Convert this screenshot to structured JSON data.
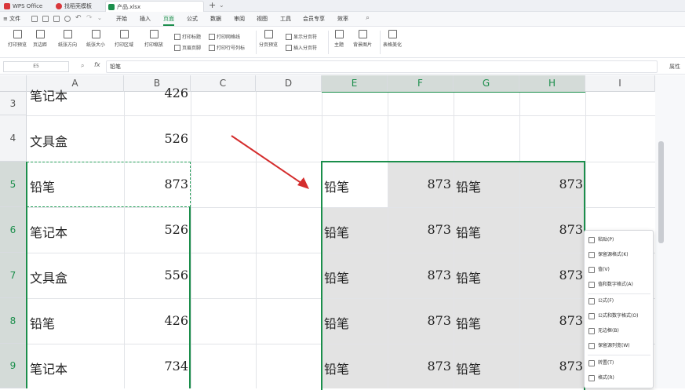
{
  "titlebar": {
    "tabs": [
      {
        "label": "WPS Office",
        "color": "#d9373b"
      },
      {
        "label": "找稻壳模板",
        "color": "#d9373b"
      },
      {
        "label": "产品.xlsx",
        "color": "#1b8e4b"
      }
    ],
    "new_tab": "+",
    "dropdown": "⌄"
  },
  "menubar": {
    "file": "文件",
    "items": [
      "开始",
      "插入",
      "页面",
      "公式",
      "数据",
      "审阅",
      "视图",
      "工具",
      "会员专享",
      "效率"
    ],
    "active_index": 2
  },
  "ribbon": {
    "buttons": [
      "打印预览",
      "页边距",
      "纸张方向",
      "纸张大小",
      "打印区域",
      "打印缩放",
      "分页预览",
      "主题",
      "背景图片",
      "表格美化"
    ],
    "small": [
      "打印标题",
      "页眉页脚",
      "打印网格线",
      "打印行号列标",
      "显示分页符",
      "插入分页符"
    ]
  },
  "formula_bar": {
    "cell_ref": "E5",
    "fx": "fx",
    "content": "铅笔",
    "side_panel": "属性"
  },
  "grid": {
    "columns": [
      "A",
      "B",
      "C",
      "D",
      "E",
      "F",
      "G",
      "H",
      "I"
    ],
    "selected_columns": [
      "E",
      "F",
      "G",
      "H"
    ],
    "rows": [
      {
        "num": "3",
        "a": "笔记本",
        "b": "426",
        "e": "",
        "f": "",
        "g": "",
        "h": ""
      },
      {
        "num": "4",
        "a": "文具盒",
        "b": "526",
        "e": "",
        "f": "",
        "g": "",
        "h": ""
      },
      {
        "num": "5",
        "a": "铅笔",
        "b": "873",
        "e": "铅笔",
        "f": "873",
        "g": "铅笔",
        "h": "873"
      },
      {
        "num": "6",
        "a": "笔记本",
        "b": "526",
        "e": "铅笔",
        "f": "873",
        "g": "铅笔",
        "h": "873"
      },
      {
        "num": "7",
        "a": "文具盒",
        "b": "556",
        "e": "铅笔",
        "f": "873",
        "g": "铅笔",
        "h": "873"
      },
      {
        "num": "8",
        "a": "铅笔",
        "b": "426",
        "e": "铅笔",
        "f": "873",
        "g": "铅笔",
        "h": "873"
      },
      {
        "num": "9",
        "a": "笔记本",
        "b": "734",
        "e": "铅笔",
        "f": "873",
        "g": "铅笔",
        "h": "873"
      }
    ]
  },
  "context_menu": {
    "items": [
      "粘贴(P)",
      "保留源格式(K)",
      "值(V)",
      "值和数字格式(A)",
      "公式(F)",
      "公式和数字格式(O)",
      "无边框(B)",
      "保留源列宽(W)",
      "转置(T)",
      "格式(R)"
    ]
  },
  "colors": {
    "accent": "#1b8e4b",
    "arrow": "#d42d2d",
    "selection_fill": "#e3e3e3"
  }
}
